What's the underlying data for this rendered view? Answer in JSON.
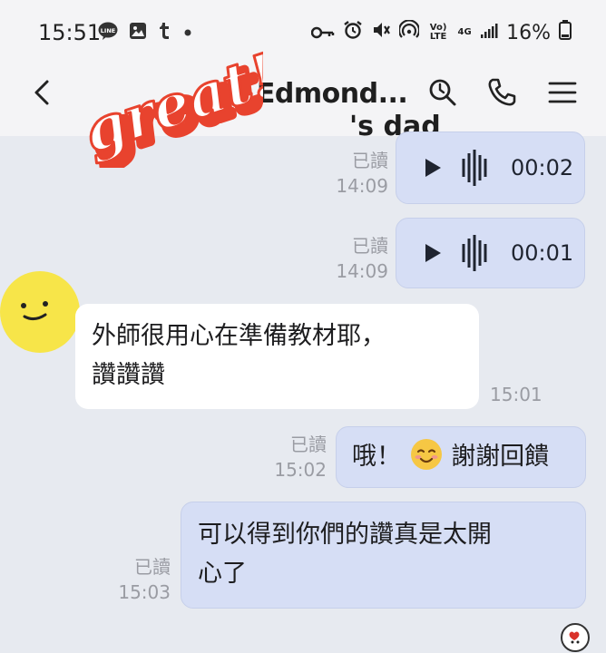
{
  "status_bar": {
    "time": "15:51",
    "left_icons": [
      "line-app-icon",
      "gallery-icon",
      "tumblr-icon",
      "notification-dot-icon"
    ],
    "right_icons": [
      "key-icon",
      "alarm-icon",
      "mute-icon",
      "hotspot-icon",
      "volte-icon",
      "4g-icon",
      "signal-icon",
      "battery-icon"
    ],
    "volte_label": "Vo) LTE",
    "net_label": "4G",
    "battery_percent": "16%"
  },
  "header": {
    "title": ".Edmond...",
    "subtitle": "'s dad",
    "sticker_text": "great!"
  },
  "messages": [
    {
      "type": "voice",
      "direction": "out",
      "read_label": "已讀",
      "time": "14:09",
      "duration": "00:02"
    },
    {
      "type": "voice",
      "direction": "out",
      "read_label": "已讀",
      "time": "14:09",
      "duration": "00:01"
    },
    {
      "type": "text",
      "direction": "in",
      "lines": [
        "外師很用心在準備教材耶，",
        "讚讚讚"
      ],
      "time": "15:01"
    },
    {
      "type": "text",
      "direction": "out",
      "read_label": "已讀",
      "time": "15:02",
      "text_before": "哦！",
      "text_after": "謝謝回饋"
    },
    {
      "type": "text",
      "direction": "out",
      "read_label": "已讀",
      "time": "15:03",
      "lines": [
        "可以得到你們的讚真是太開",
        "心了"
      ]
    }
  ],
  "colors": {
    "outgoing_bubble": "#d6def5",
    "incoming_bubble": "#ffffff",
    "chat_background": "#e7eaf0",
    "avatar": "#f7e549",
    "sticker_red": "#e8432e"
  }
}
